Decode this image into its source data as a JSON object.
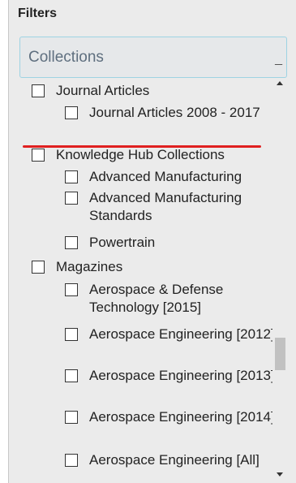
{
  "filters": {
    "title": "Filters",
    "collections_label": "Collections",
    "collapse_symbol": "_"
  },
  "items": [
    {
      "label": "Journal Articles",
      "level": 1,
      "checked": false
    },
    {
      "label": "Journal Articles 2008 - 2017",
      "level": 2,
      "checked": false
    },
    {
      "label": "Knowledge Hub Collections",
      "level": 1,
      "checked": false
    },
    {
      "label": "Advanced Manufacturing",
      "level": 2,
      "checked": false
    },
    {
      "label": "Advanced Manufacturing Standards",
      "level": 2,
      "checked": false
    },
    {
      "label": "Powertrain",
      "level": 2,
      "checked": false
    },
    {
      "label": "Magazines",
      "level": 1,
      "checked": false
    },
    {
      "label": "Aerospace & Defense Technology [2015]",
      "level": 2,
      "checked": false
    },
    {
      "label": "Aerospace Engineering [2012]",
      "level": 2,
      "checked": false
    },
    {
      "label": "Aerospace Engineering [2013]",
      "level": 2,
      "checked": false
    },
    {
      "label": "Aerospace Engineering [2014]",
      "level": 2,
      "checked": false
    },
    {
      "label": "Aerospace Engineering [All]",
      "level": 2,
      "checked": false
    }
  ],
  "annotation_color": "#e02020"
}
